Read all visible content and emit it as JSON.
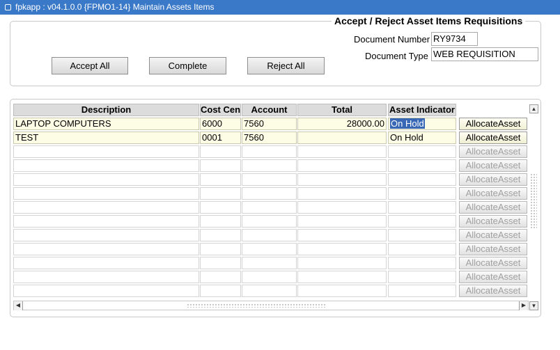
{
  "window": {
    "title": "fpkapp : v04.1.0.0  {FPMO1-14} Maintain Assets Items",
    "icon": "app-window-icon"
  },
  "header": {
    "section_title": "Accept / Reject Asset Items Requisitions",
    "document_number_label": "Document Number",
    "document_number_value": "RY9734",
    "document_type_label": "Document Type",
    "document_type_value": "WEB REQUISITION"
  },
  "toolbar": {
    "accept_all_label": "Accept All",
    "complete_label": "Complete",
    "reject_all_label": "Reject All"
  },
  "grid": {
    "columns": [
      "Description",
      "Cost Cen",
      "Account",
      "Total",
      "Asset Indicator"
    ],
    "rows": [
      {
        "description": "LAPTOP COMPUTERS",
        "cost_centre": "6000",
        "account": "7560",
        "total": "28000.00",
        "asset_indicator": "On Hold",
        "action": "AllocateAsset"
      },
      {
        "description": "TEST",
        "cost_centre": "0001",
        "account": "7560",
        "total": "",
        "asset_indicator": "On Hold",
        "action": "AllocateAsset"
      },
      {
        "description": "",
        "cost_centre": "",
        "account": "",
        "total": "",
        "asset_indicator": "",
        "action": "AllocateAsset"
      },
      {
        "description": "",
        "cost_centre": "",
        "account": "",
        "total": "",
        "asset_indicator": "",
        "action": "AllocateAsset"
      },
      {
        "description": "",
        "cost_centre": "",
        "account": "",
        "total": "",
        "asset_indicator": "",
        "action": "AllocateAsset"
      },
      {
        "description": "",
        "cost_centre": "",
        "account": "",
        "total": "",
        "asset_indicator": "",
        "action": "AllocateAsset"
      },
      {
        "description": "",
        "cost_centre": "",
        "account": "",
        "total": "",
        "asset_indicator": "",
        "action": "AllocateAsset"
      },
      {
        "description": "",
        "cost_centre": "",
        "account": "",
        "total": "",
        "asset_indicator": "",
        "action": "AllocateAsset"
      },
      {
        "description": "",
        "cost_centre": "",
        "account": "",
        "total": "",
        "asset_indicator": "",
        "action": "AllocateAsset"
      },
      {
        "description": "",
        "cost_centre": "",
        "account": "",
        "total": "",
        "asset_indicator": "",
        "action": "AllocateAsset"
      },
      {
        "description": "",
        "cost_centre": "",
        "account": "",
        "total": "",
        "asset_indicator": "",
        "action": "AllocateAsset"
      },
      {
        "description": "",
        "cost_centre": "",
        "account": "",
        "total": "",
        "asset_indicator": "",
        "action": "AllocateAsset"
      },
      {
        "description": "",
        "cost_centre": "",
        "account": "",
        "total": "",
        "asset_indicator": "",
        "action": "AllocateAsset"
      }
    ]
  },
  "colors": {
    "titlebar": "#3a78c8",
    "selection": "#3867b6",
    "filled_cell": "#fdfde6"
  }
}
